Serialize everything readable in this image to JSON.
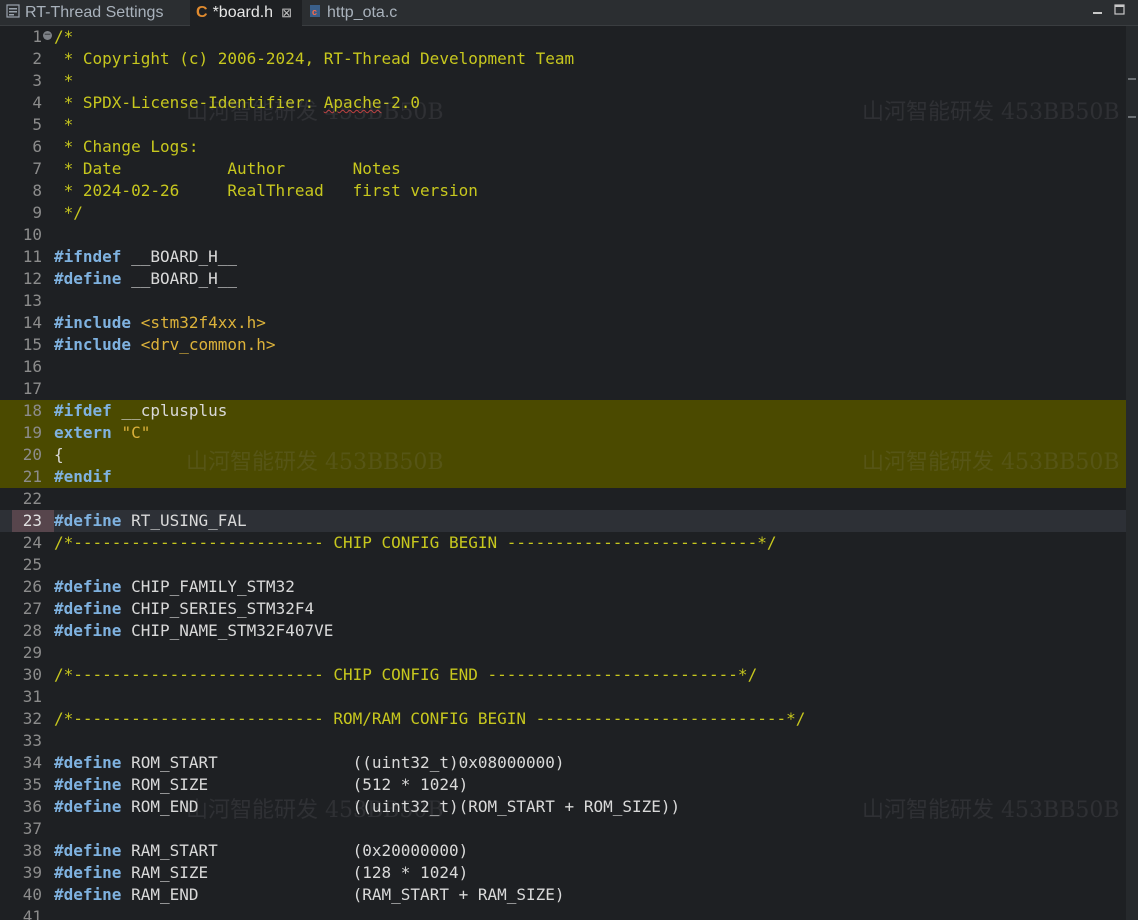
{
  "tabs": [
    {
      "label": "RT-Thread Settings",
      "icon": "settings-icon",
      "active": false
    },
    {
      "label": "*board.h",
      "icon": "c-header-icon",
      "active": true,
      "close": "⊠"
    },
    {
      "label": "http_ota.c",
      "icon": "c-source-icon",
      "active": false
    }
  ],
  "watermark": "山河智能研发 453BB50B",
  "lines": [
    {
      "n": "1",
      "tokens": [
        {
          "t": "/*",
          "c": "comment"
        }
      ],
      "fold": true
    },
    {
      "n": "2",
      "tokens": [
        {
          "t": " * Copyright (c) 2006-2024, RT-Thread Development Team",
          "c": "comment"
        }
      ]
    },
    {
      "n": "3",
      "tokens": [
        {
          "t": " *",
          "c": "comment"
        }
      ]
    },
    {
      "n": "4",
      "tokens": [
        {
          "t": " * SPDX-License-Identifier: ",
          "c": "comment"
        },
        {
          "t": "Apache",
          "c": "comment",
          "sq": true
        },
        {
          "t": "-2.0",
          "c": "comment"
        }
      ]
    },
    {
      "n": "5",
      "tokens": [
        {
          "t": " *",
          "c": "comment"
        }
      ]
    },
    {
      "n": "6",
      "tokens": [
        {
          "t": " * Change Logs:",
          "c": "comment"
        }
      ]
    },
    {
      "n": "7",
      "tokens": [
        {
          "t": " * Date           Author       Notes",
          "c": "comment"
        }
      ]
    },
    {
      "n": "8",
      "tokens": [
        {
          "t": " * 2024-02-26     RealThread   first version",
          "c": "comment"
        }
      ]
    },
    {
      "n": "9",
      "tokens": [
        {
          "t": " */",
          "c": "comment"
        }
      ]
    },
    {
      "n": "10",
      "tokens": []
    },
    {
      "n": "11",
      "tokens": [
        {
          "t": "#ifndef",
          "c": "kw"
        },
        {
          "t": " __BOARD_H__",
          "c": "plain"
        }
      ]
    },
    {
      "n": "12",
      "tokens": [
        {
          "t": "#define",
          "c": "kw"
        },
        {
          "t": " __BOARD_H__",
          "c": "plain"
        }
      ]
    },
    {
      "n": "13",
      "tokens": []
    },
    {
      "n": "14",
      "tokens": [
        {
          "t": "#include",
          "c": "kw"
        },
        {
          "t": " ",
          "c": "plain"
        },
        {
          "t": "<stm32f4xx.h>",
          "c": "inc"
        }
      ]
    },
    {
      "n": "15",
      "tokens": [
        {
          "t": "#include",
          "c": "kw"
        },
        {
          "t": " ",
          "c": "plain"
        },
        {
          "t": "<drv_common.h>",
          "c": "inc"
        }
      ]
    },
    {
      "n": "16",
      "tokens": []
    },
    {
      "n": "17",
      "tokens": []
    },
    {
      "n": "18",
      "tokens": [
        {
          "t": "#ifdef",
          "c": "kw"
        },
        {
          "t": " __cplusplus",
          "c": "plain"
        }
      ],
      "hl": true
    },
    {
      "n": "19",
      "tokens": [
        {
          "t": "extern",
          "c": "kw"
        },
        {
          "t": " ",
          "c": "plain"
        },
        {
          "t": "\"C\"",
          "c": "str"
        }
      ],
      "hl": true
    },
    {
      "n": "20",
      "tokens": [
        {
          "t": "{",
          "c": "plain"
        }
      ],
      "hl": true
    },
    {
      "n": "21",
      "tokens": [
        {
          "t": "#endif",
          "c": "kw"
        }
      ],
      "hl": true
    },
    {
      "n": "22",
      "tokens": []
    },
    {
      "n": "23",
      "tokens": [
        {
          "t": "#define",
          "c": "kw"
        },
        {
          "t": " RT_USING_FAL",
          "c": "plain"
        }
      ],
      "current": true
    },
    {
      "n": "24",
      "tokens": [
        {
          "t": "/*-------------------------- CHIP CONFIG BEGIN --------------------------*/",
          "c": "comment"
        }
      ]
    },
    {
      "n": "25",
      "tokens": []
    },
    {
      "n": "26",
      "tokens": [
        {
          "t": "#define",
          "c": "kw"
        },
        {
          "t": " CHIP_FAMILY_STM32",
          "c": "plain"
        }
      ]
    },
    {
      "n": "27",
      "tokens": [
        {
          "t": "#define",
          "c": "kw"
        },
        {
          "t": " CHIP_SERIES_STM32F4",
          "c": "plain"
        }
      ]
    },
    {
      "n": "28",
      "tokens": [
        {
          "t": "#define",
          "c": "kw"
        },
        {
          "t": " CHIP_NAME_STM32F407VE",
          "c": "plain"
        }
      ]
    },
    {
      "n": "29",
      "tokens": []
    },
    {
      "n": "30",
      "tokens": [
        {
          "t": "/*-------------------------- CHIP CONFIG END --------------------------*/",
          "c": "comment"
        }
      ]
    },
    {
      "n": "31",
      "tokens": []
    },
    {
      "n": "32",
      "tokens": [
        {
          "t": "/*-------------------------- ROM/RAM CONFIG BEGIN --------------------------*/",
          "c": "comment"
        }
      ]
    },
    {
      "n": "33",
      "tokens": []
    },
    {
      "n": "34",
      "tokens": [
        {
          "t": "#define",
          "c": "kw"
        },
        {
          "t": " ROM_START              ((uint32_t)0x08000000)",
          "c": "plain"
        }
      ]
    },
    {
      "n": "35",
      "tokens": [
        {
          "t": "#define",
          "c": "kw"
        },
        {
          "t": " ROM_SIZE               (512 * 1024)",
          "c": "plain"
        }
      ]
    },
    {
      "n": "36",
      "tokens": [
        {
          "t": "#define",
          "c": "kw"
        },
        {
          "t": " ROM_END                ((uint32_t)(ROM_START + ROM_SIZE))",
          "c": "plain"
        }
      ]
    },
    {
      "n": "37",
      "tokens": []
    },
    {
      "n": "38",
      "tokens": [
        {
          "t": "#define",
          "c": "kw"
        },
        {
          "t": " RAM_START              (0x20000000)",
          "c": "plain"
        }
      ]
    },
    {
      "n": "39",
      "tokens": [
        {
          "t": "#define",
          "c": "kw"
        },
        {
          "t": " RAM_SIZE               (128 * 1024)",
          "c": "plain"
        }
      ]
    },
    {
      "n": "40",
      "tokens": [
        {
          "t": "#define",
          "c": "kw"
        },
        {
          "t": " RAM_END                (RAM_START + RAM_SIZE)",
          "c": "plain"
        }
      ]
    },
    {
      "n": "41",
      "tokens": []
    }
  ]
}
